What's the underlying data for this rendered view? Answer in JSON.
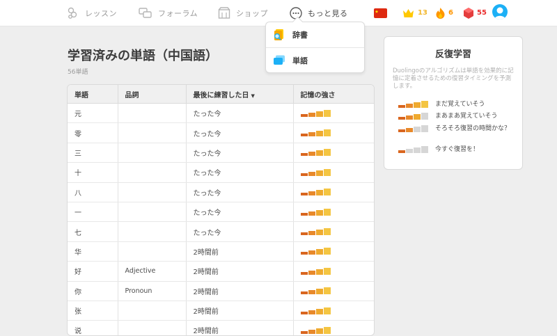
{
  "nav": {
    "lessons": "レッスン",
    "forum": "フォーラム",
    "shop": "ショップ",
    "more": "もっと見る"
  },
  "stats": {
    "crowns": "13",
    "streak": "6",
    "gems": "55"
  },
  "dropdown": {
    "dictionary": "辞書",
    "words": "単語"
  },
  "page": {
    "title": "学習済みの単語（中国語）",
    "count": "56単語"
  },
  "table": {
    "headers": {
      "word": "単語",
      "pos": "品詞",
      "last_practiced": "最後に練習した日",
      "strength": "記憶の強さ"
    },
    "rows": [
      {
        "word": "元",
        "pos": "",
        "last": "たった今",
        "strength": 4
      },
      {
        "word": "零",
        "pos": "",
        "last": "たった今",
        "strength": 4
      },
      {
        "word": "三",
        "pos": "",
        "last": "たった今",
        "strength": 4
      },
      {
        "word": "十",
        "pos": "",
        "last": "たった今",
        "strength": 4
      },
      {
        "word": "八",
        "pos": "",
        "last": "たった今",
        "strength": 4
      },
      {
        "word": "一",
        "pos": "",
        "last": "たった今",
        "strength": 4
      },
      {
        "word": "七",
        "pos": "",
        "last": "たった今",
        "strength": 4
      },
      {
        "word": "华",
        "pos": "",
        "last": "2時間前",
        "strength": 4
      },
      {
        "word": "好",
        "pos": "Adjective",
        "last": "2時間前",
        "strength": 4
      },
      {
        "word": "你",
        "pos": "Pronoun",
        "last": "2時間前",
        "strength": 4
      },
      {
        "word": "张",
        "pos": "",
        "last": "2時間前",
        "strength": 4
      },
      {
        "word": "说",
        "pos": "",
        "last": "2時間前",
        "strength": 4
      }
    ]
  },
  "sidebar": {
    "title": "反復学習",
    "description": "Duolingoのアルゴリズムは単語を効果的に記憶に定着させるための復習タイミングを予測します。",
    "legend": [
      {
        "label": "まだ覚えていそう",
        "level": 4
      },
      {
        "label": "まあまあ覚えていそう",
        "level": 3
      },
      {
        "label": "そろそろ復習の時間かな？",
        "level": 2
      },
      {
        "label": "今すぐ復習を！",
        "level": 1
      }
    ]
  },
  "colors": {
    "bar_1": "#d9661f",
    "bar_2": "#e8892a",
    "bar_3": "#efaa2f",
    "bar_4": "#f4c542",
    "bar_off": "#d6d6d6",
    "accent_blue": "#1cb0f6"
  }
}
